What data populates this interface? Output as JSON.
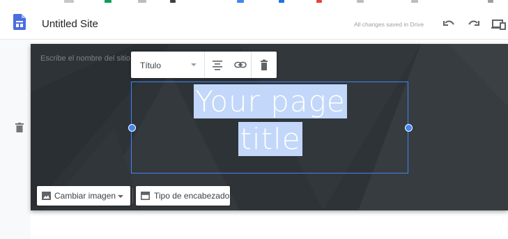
{
  "header": {
    "site_title": "Untitled Site",
    "save_status": "All changes saved in Drive",
    "undo_icon": "undo-icon",
    "redo_icon": "redo-icon",
    "preview_icon": "preview-devices-icon",
    "logo_icon": "google-sites-icon"
  },
  "banner": {
    "site_name_placeholder": "Escribe el nombre del sitio",
    "page_title_line1": "Your page",
    "page_title_line2": "title"
  },
  "toolbar": {
    "style_label": "Título",
    "align_icon": "align-center-icon",
    "link_icon": "link-icon",
    "delete_icon": "trash-icon"
  },
  "banner_actions": {
    "change_image_label": "Cambiar imagen",
    "header_type_label": "Tipo de encabezado"
  },
  "rail": {
    "delete_icon": "trash-icon"
  },
  "colors": {
    "accent": "#4285f4",
    "banner_bg": "#2c3135",
    "selection": "#c2d7f9"
  }
}
